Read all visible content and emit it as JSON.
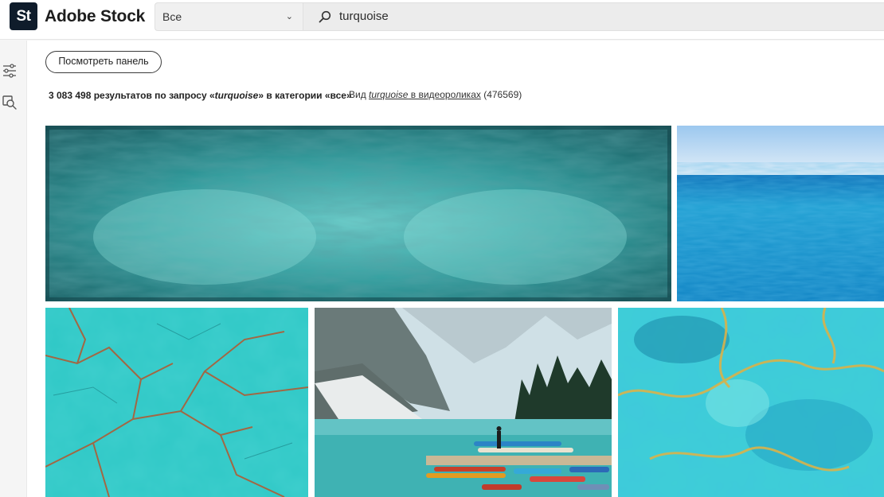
{
  "header": {
    "logo_text": "St",
    "brand": "Adobe Stock",
    "scope_selected": "Все",
    "search_query": "turquoise"
  },
  "rail": {
    "icons": [
      "filters-icon",
      "visual-search-icon"
    ]
  },
  "toolbar": {
    "panel_button": "Посмотреть панель"
  },
  "results": {
    "lead": "3 083 498 результатов по запросу «",
    "query": "turquoise",
    "tail": "» в категории «все»",
    "videos_prefix": "Вид ",
    "videos_link_query": "turquoise",
    "videos_link_suffix": " в видеороликах",
    "videos_count": " (476569)"
  },
  "images": [
    "turquoise-grunge-texture",
    "turquoise-sea",
    "turquoise-stone-texture",
    "mountain-lake-canoes",
    "turquoise-gold-alcohol-ink"
  ],
  "colors": {
    "accent_dark": "#0f1c2b",
    "turquoise": "#2ec6c8"
  }
}
